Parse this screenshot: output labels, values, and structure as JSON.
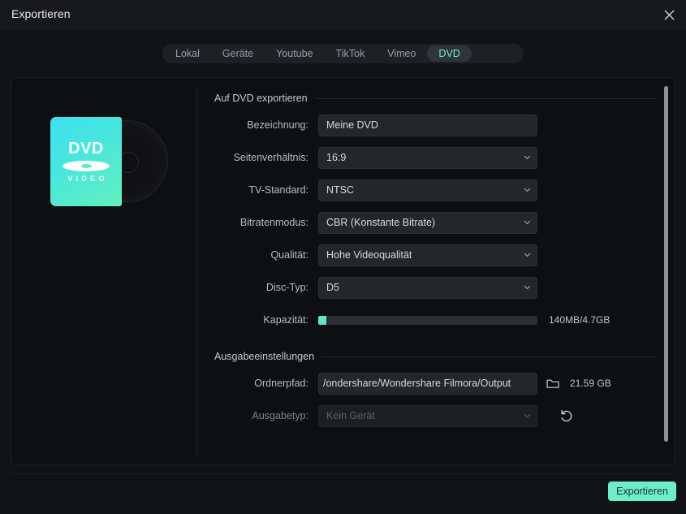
{
  "window": {
    "title": "Exportieren",
    "close_icon": "close-icon"
  },
  "tabs": [
    {
      "label": "Lokal",
      "selected": false
    },
    {
      "label": "Geräte",
      "selected": false
    },
    {
      "label": "Youtube",
      "selected": false
    },
    {
      "label": "TikTok",
      "selected": false
    },
    {
      "label": "Vimeo",
      "selected": false
    },
    {
      "label": "DVD",
      "selected": true
    }
  ],
  "artwork": {
    "icon": "dvd-case-icon",
    "title": "DVD",
    "subtitle": "VIDEO"
  },
  "sections": {
    "dvd": {
      "heading": "Auf DVD exportieren",
      "rows": {
        "name": {
          "label": "Bezeichnung:",
          "value": "Meine DVD",
          "placeholder": "Meine DVD"
        },
        "aspect_ratio": {
          "label": "Seitenverhältnis:",
          "value": "16:9"
        },
        "tv_standard": {
          "label": "TV-Standard:",
          "value": "NTSC"
        },
        "bitrate_mode": {
          "label": "Bitratenmodus:",
          "value": "CBR (Konstante Bitrate)"
        },
        "quality": {
          "label": "Qualität:",
          "value": "Hohe Videoqualität"
        },
        "disc_type": {
          "label": "Disc-Typ:",
          "value": "D5"
        },
        "capacity": {
          "label": "Kapazität:",
          "used": "140MB",
          "total": "4.7GB",
          "readout": "140MB/4.7GB",
          "percent": 3.7
        }
      }
    },
    "output": {
      "heading": "Ausgabeeinstellungen",
      "rows": {
        "folder_path": {
          "label": "Ordnerpfad:",
          "value": "/ondershare/Wondershare Filmora/Output",
          "browse_icon": "folder-icon",
          "free_space": "21.59 GB"
        },
        "output_type": {
          "label": "Ausgabetyp:",
          "value": "Kein Gerät",
          "disabled": true,
          "reset_icon": "reset-icon"
        }
      }
    }
  },
  "footer": {
    "export_label": "Exportieren"
  },
  "scrollbar": {
    "name": "vertical-scrollbar"
  },
  "colors": {
    "accent": "#6deecb",
    "accent_tab_text": "#6feed0",
    "capacity_fill": "#5fe8c4",
    "window_bg": "#121316",
    "panel_bg": "#0e0f11",
    "field_bg": "#23262b"
  }
}
